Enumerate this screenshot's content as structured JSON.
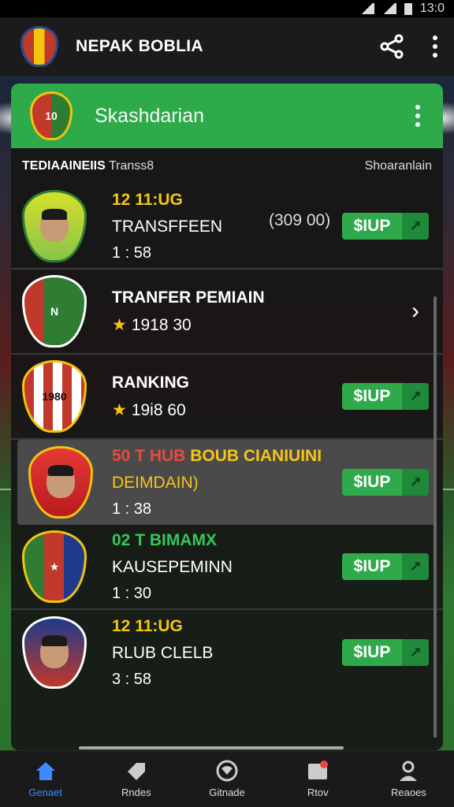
{
  "status_bar": {
    "time": "13:0"
  },
  "app_bar": {
    "title": "NEPAK BOBLIA",
    "share_icon": "share-icon",
    "menu_icon": "more-vertical-icon"
  },
  "panel": {
    "title": "Skashdarian",
    "subheader_left_bold": "TEDIAAINEIIS",
    "subheader_left": "Transs8",
    "subheader_right": "Shoaranlain"
  },
  "rows": [
    {
      "line1": "12  11:UG",
      "line1_color": "#f5c518",
      "line2": "TRANSFFEEN",
      "line3": "1 : 58",
      "price": "(309 00)",
      "button": "$IUP"
    },
    {
      "line1": "TRANFER PEMIAIN",
      "line1_color": "#ffffff",
      "line2": "1918 30",
      "line3": "",
      "price": "",
      "button": ""
    },
    {
      "line1": "RANKING",
      "line1_color": "#ffffff",
      "line2": "19i8 60",
      "line3": "",
      "price": "",
      "button": "$IUP"
    },
    {
      "line1_a": "50  T HUB",
      "line1_b": "BOUB CIANIUINI",
      "line2": "DEIMDAIN)",
      "line3": "1 : 38",
      "button": "$IUP"
    },
    {
      "line1": "02  T BIMAMX",
      "line1_color": "#34c759",
      "line2": "KAUSEPEMINN",
      "line3": "1 : 30",
      "button": "$IUP"
    },
    {
      "line1": "12  11:UG",
      "line1_color": "#f5c518",
      "line2": "RLUB  CLELB",
      "line3": "3 : 58",
      "button": "$IUP"
    }
  ],
  "bottom_nav": [
    {
      "label": "Genaet",
      "icon": "home-icon",
      "active": true
    },
    {
      "label": "Rndes",
      "icon": "tag-icon",
      "active": false
    },
    {
      "label": "Gitnade",
      "icon": "ball-icon",
      "active": false
    },
    {
      "label": "Rtov",
      "icon": "inbox-icon",
      "active": false
    },
    {
      "label": "Reaoes",
      "icon": "person-icon",
      "active": false
    }
  ],
  "colors": {
    "accent_green": "#2eaa4a",
    "active_blue": "#3d8bff",
    "yellow": "#f5c518",
    "red": "#e74c3c"
  }
}
